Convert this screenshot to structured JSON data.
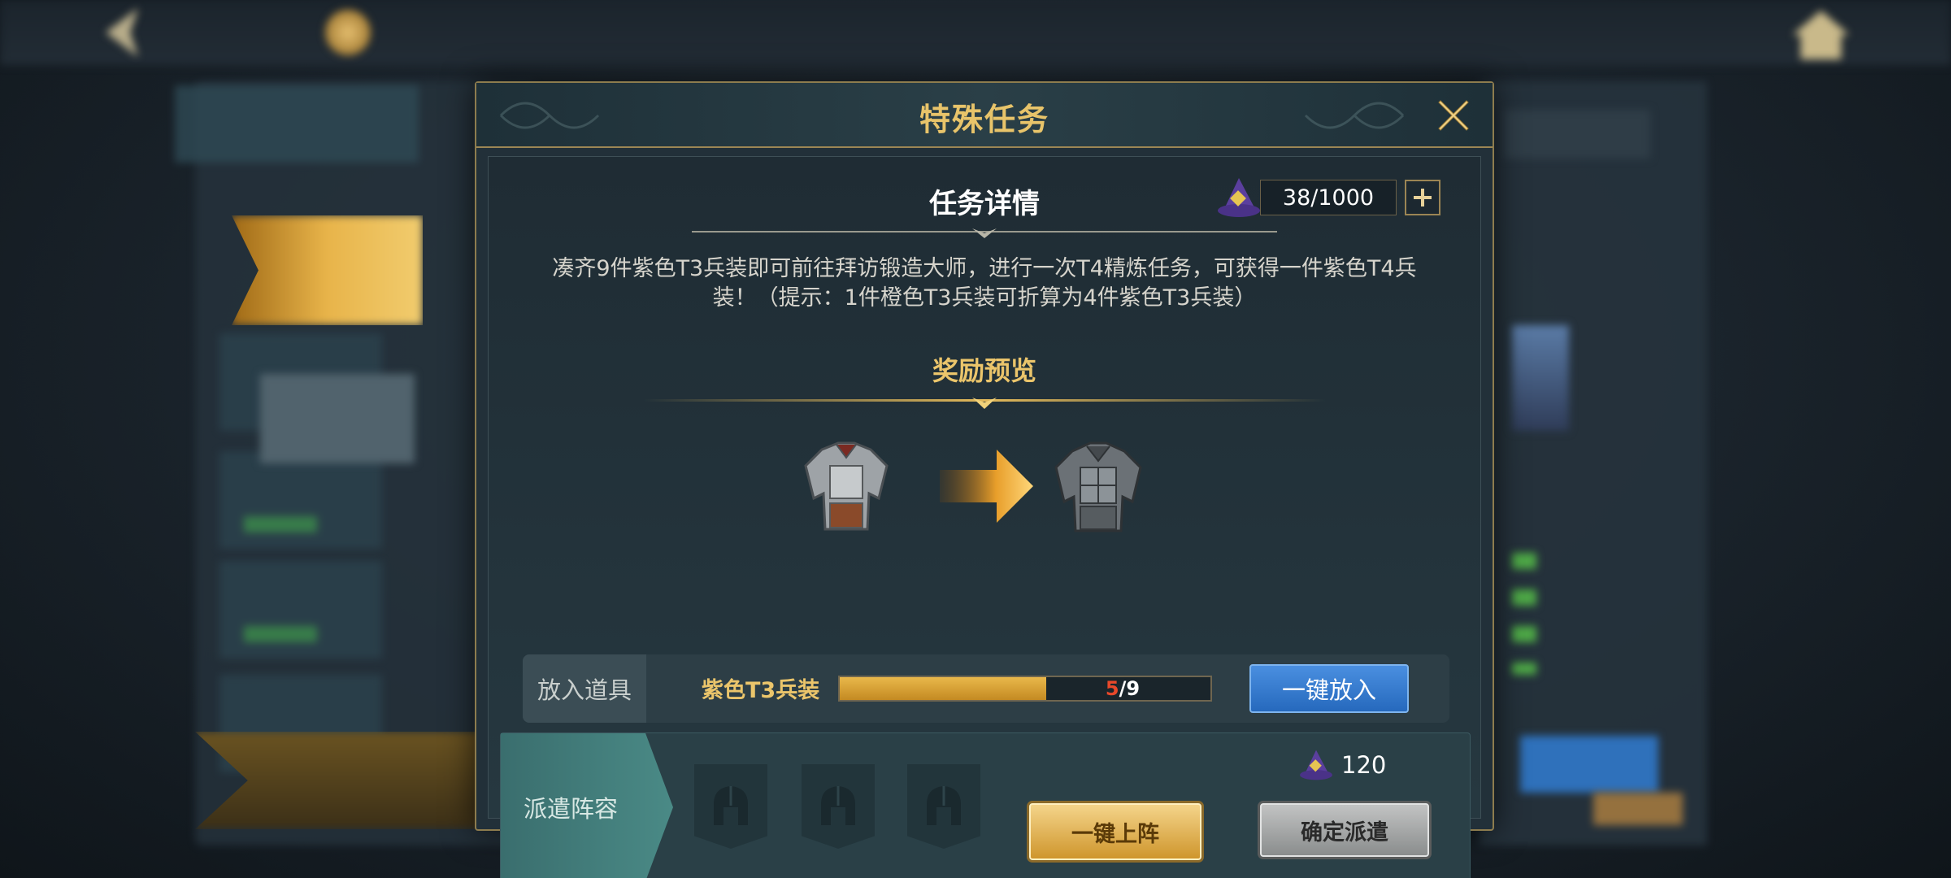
{
  "modal": {
    "title": "特殊任务",
    "close_label": "X"
  },
  "details": {
    "title": "任务详情",
    "description": "凑齐9件紫色T3兵装即可前往拜访锻造大师，进行一次T4精炼任务，可获得一件紫色T4兵装！（提示：1件橙色T3兵装可折算为4件紫色T3兵装）"
  },
  "stamina": {
    "icon": "wizard-hat-icon",
    "value": "38/1000",
    "plus_label": "+"
  },
  "rewards": {
    "title": "奖励预览",
    "from_item_icon": "purple-t3-armor-icon",
    "to_item_icon": "purple-t4-armor-icon"
  },
  "put_items": {
    "label": "放入道具",
    "item_name": "紫色T3兵装",
    "progress_current": "5",
    "progress_sep": "/",
    "progress_total": "9",
    "progress_fraction": 0.556,
    "button_label": "一键放入"
  },
  "dispatch": {
    "label": "派遣阵容",
    "slots": [
      "helmet-slot-icon",
      "helmet-slot-icon",
      "helmet-slot-icon"
    ],
    "cost_icon": "wizard-hat-icon",
    "cost": "120",
    "auto_deploy_label": "一键上阵",
    "confirm_label": "确定派遣"
  },
  "colors": {
    "gold_title": "#e8c46a",
    "blue_button": "#2f7bd0",
    "progress_fill": "#d9a238",
    "progress_current": "#e8482a"
  }
}
